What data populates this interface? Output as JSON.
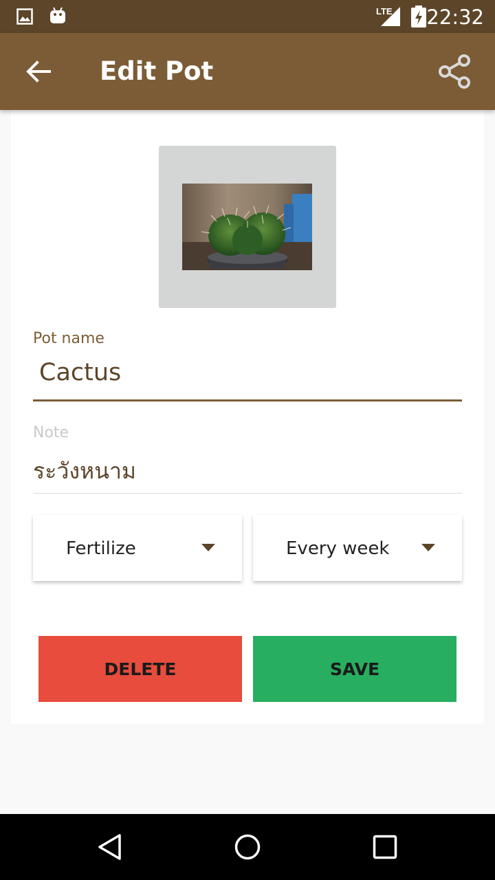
{
  "status_bar": {
    "time": "22:32",
    "network": "LTE",
    "icons": [
      "image-icon",
      "android-icon",
      "signal-icon",
      "battery-charging-icon"
    ]
  },
  "app_bar": {
    "title": "Edit Pot",
    "back_icon": "arrow-back-icon",
    "share_icon": "share-icon"
  },
  "form": {
    "pot_name_label": "Pot name",
    "pot_name_value": "Cactus",
    "note_label": "Note",
    "note_value": "ระวังหนาม",
    "action_spinner": "Fertilize",
    "frequency_spinner": "Every week"
  },
  "buttons": {
    "delete_label": "DELETE",
    "save_label": "SAVE"
  },
  "colors": {
    "primary": "#7c5c37",
    "primary_dark": "#5c4529",
    "delete": "#e74c3c",
    "save": "#27ae60",
    "photo_frame": "#d4d6d5"
  }
}
